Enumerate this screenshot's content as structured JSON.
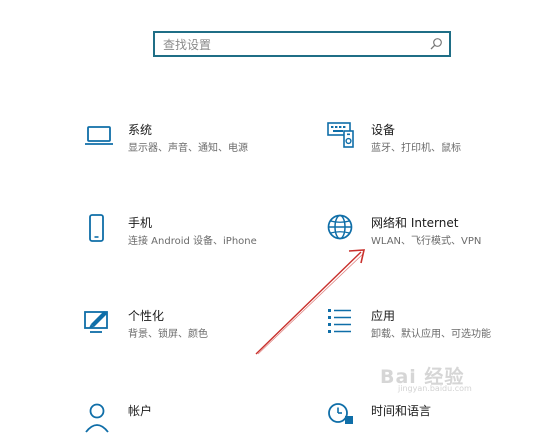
{
  "search": {
    "placeholder": "查找设置"
  },
  "tiles": [
    {
      "title": "系统",
      "desc": "显示器、声音、通知、电源",
      "icon": "laptop-icon"
    },
    {
      "title": "设备",
      "desc": "蓝牙、打印机、鼠标",
      "icon": "keyboard-devices-icon"
    },
    {
      "title": "手机",
      "desc": "连接 Android 设备、iPhone",
      "icon": "phone-icon"
    },
    {
      "title": "网络和 Internet",
      "desc": "WLAN、飞行模式、VPN",
      "icon": "globe-icon"
    },
    {
      "title": "个性化",
      "desc": "背景、锁屏、颜色",
      "icon": "personalization-icon"
    },
    {
      "title": "应用",
      "desc": "卸载、默认应用、可选功能",
      "icon": "apps-list-icon"
    },
    {
      "title": "帐户",
      "desc": "",
      "icon": "account-icon"
    },
    {
      "title": "时间和语言",
      "desc": "",
      "icon": "time-language-icon"
    }
  ],
  "colors": {
    "accent": "#0f6ea8",
    "search_border": "#1f6e86",
    "arrow": "#c9302c"
  },
  "watermark": {
    "text": "Bai 经验",
    "sub": "jingyan.baidu.com"
  }
}
